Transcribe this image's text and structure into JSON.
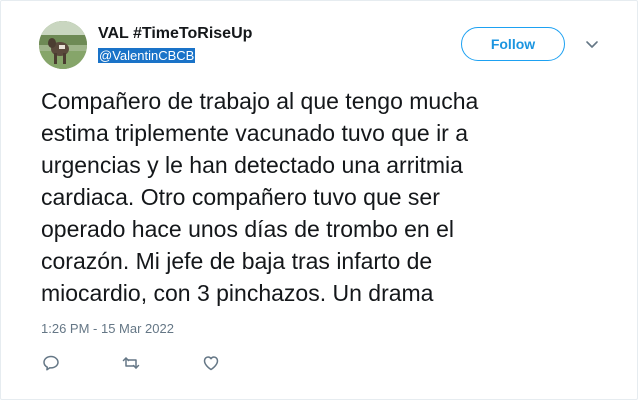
{
  "user": {
    "display_name": "VAL #TimeToRiseUp",
    "handle": "@ValentinCBCB"
  },
  "follow_button": {
    "label": "Follow"
  },
  "tweet": {
    "text": "Compañero de trabajo al que tengo mucha\nestima triplemente vacunado tuvo que ir a\nurgencias y le han detectado una arritmia\ncardiaca. Otro compañero tuvo que ser\noperado hace unos días de trombo en el\ncorazón. Mi jefe de baja tras infarto de\nmiocardio, con 3 pinchazos. Un drama",
    "timestamp": "1:26 PM - 15 Mar 2022"
  },
  "icons": {
    "more": "chevron-down-icon",
    "reply": "reply-icon",
    "retweet": "retweet-icon",
    "like": "heart-icon"
  },
  "colors": {
    "accent": "#1da1f2",
    "handle_highlight": "#1a73c8",
    "muted": "#657786",
    "text": "#14171a"
  }
}
